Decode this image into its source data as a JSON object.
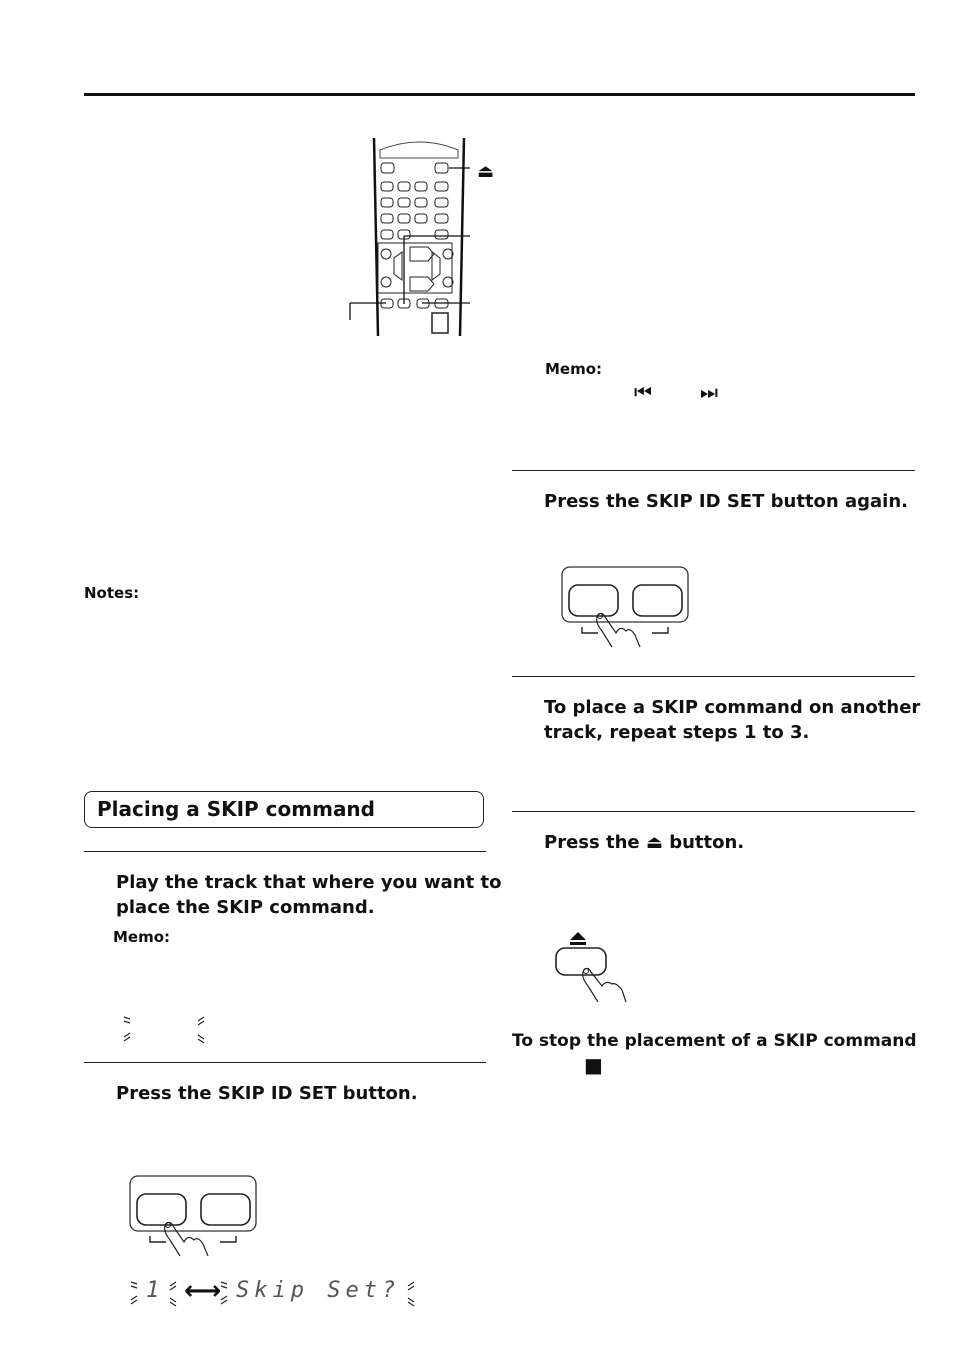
{
  "page": {
    "left_column": {
      "notes_label": "Notes:",
      "section_title": "Placing a SKIP command",
      "steps": [
        {
          "text_line1": "Play the track that where you want to",
          "text_line2": "place the SKIP command.",
          "memo_label": "Memo:"
        },
        {
          "text": "Press the SKIP ID SET button."
        }
      ],
      "display_readout": {
        "track": "1",
        "arrow": "⟷",
        "message": "Skip Set?"
      }
    },
    "right_column": {
      "memo_label": "Memo:",
      "memo_icons": {
        "prev": "⏮",
        "next": "⏭"
      },
      "steps": [
        {
          "text": "Press the SKIP ID SET button again."
        },
        {
          "text_line1": "To place a SKIP command on another",
          "text_line2": "track, repeat steps 1 to 3."
        },
        {
          "text_before": "Press the",
          "icon": "⏏",
          "text_after": "button."
        }
      ],
      "stop_heading": "To stop the placement of a SKIP command",
      "stop_icon": "■"
    },
    "remote_callouts": {
      "eject_icon": "⏏"
    }
  }
}
